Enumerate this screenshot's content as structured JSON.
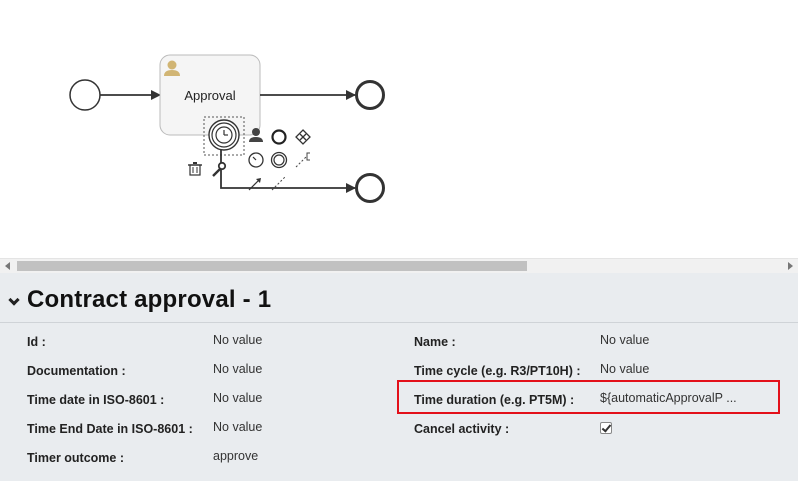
{
  "diagram": {
    "task_label": "Approval",
    "task_icon": "user-icon",
    "attached_event_icon": "timer-icon",
    "context_pad_icons": [
      "user-task-icon",
      "end-event-icon",
      "gateway-icon",
      "delete-icon",
      "wrench-icon",
      "intermediate-timer-icon",
      "intermediate-event-icon",
      "text-annotation-icon",
      "sequence-flow-icon",
      "association-icon"
    ]
  },
  "panel": {
    "title": "Contract approval - 1",
    "left_properties": [
      {
        "label": "Id :",
        "value": "No value"
      },
      {
        "label": "Documentation :",
        "value": "No value"
      },
      {
        "label": "Time date in ISO-8601 :",
        "value": "No value"
      },
      {
        "label": "Time End Date in ISO-8601 :",
        "value": "No value"
      },
      {
        "label": "Timer outcome :",
        "value": "approve"
      }
    ],
    "right_properties": [
      {
        "label": "Name :",
        "value": "No value"
      },
      {
        "label": "Time cycle (e.g. R3/PT10H) :",
        "value": "No value"
      },
      {
        "label": "Time duration (e.g. PT5M) :",
        "value": "${automaticApprovalP ..."
      },
      {
        "label": "Cancel activity :",
        "checked": true
      }
    ]
  },
  "colors": {
    "highlight": "#e3101a",
    "panel_bg": "#e9ecef",
    "task_fill": "#f5f5f5",
    "user_icon": "#d1b574"
  }
}
